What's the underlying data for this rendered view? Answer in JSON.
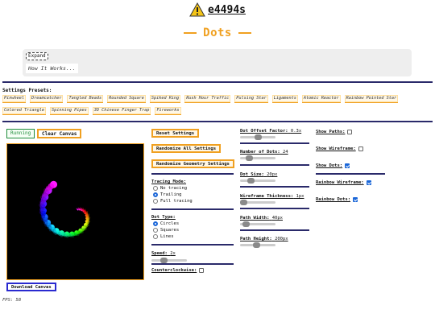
{
  "header": {
    "logo_text": "e4494s",
    "title": "Dots"
  },
  "expand": {
    "button_label": "Expand",
    "how_label": "How It Works..."
  },
  "presets": {
    "title": "Settings Presets:",
    "items": [
      "Pinwheel",
      "Dreamcatcher",
      "Tangled Beads",
      "Rounded Square",
      "Spiked Ring",
      "Rush Hour Traffic",
      "Pulsing Star",
      "Ligaments",
      "Atomic Reactor",
      "Rainbow Pointed Star",
      "Colored Triangle",
      "Spinning Pipes",
      "3D Chinese Finger Trap",
      "Fireworks"
    ]
  },
  "controls": {
    "running_label": "Running",
    "clear_label": "Clear Canvas",
    "download_label": "Download Canvas",
    "fps_label": "FPS: 58",
    "reset_label": "Reset Settings",
    "randomize_all_label": "Randomize All Settings",
    "randomize_geometry_label": "Randomize Geometry Settings"
  },
  "tracing": {
    "label": "Tracing Mode:",
    "options": [
      "No tracing",
      "Trailing",
      "Full tracing"
    ],
    "selected": "Trailing"
  },
  "dot_type": {
    "label": "Dot Type:",
    "options": [
      "Circles",
      "Squares",
      "Lines"
    ],
    "selected": "Circles"
  },
  "speed": {
    "label": "Speed:",
    "value": "2x",
    "level": 0.35
  },
  "counterclockwise": {
    "label": "Counterclockwise:",
    "checked": false
  },
  "dot_offset": {
    "label": "Dot Offset Factor:",
    "value": "0.3x",
    "level": 0.5
  },
  "num_dots": {
    "label": "Number of Dots:",
    "value": "24",
    "level": 0.25
  },
  "dot_size": {
    "label": "Dot Size:",
    "value": "20px",
    "level": 0.3
  },
  "wireframe_thickness": {
    "label": "Wireframe Thickness:",
    "value": "1px",
    "level": 0.05
  },
  "path_width": {
    "label": "Path Width:",
    "value": "40px",
    "level": 0.15
  },
  "path_height": {
    "label": "Path Height:",
    "value": "200px",
    "level": 0.45
  },
  "toggles": {
    "show_paths": {
      "label": "Show Paths:",
      "checked": false
    },
    "show_wireframe": {
      "label": "Show Wireframe:",
      "checked": false
    },
    "show_dots": {
      "label": "Show Dots:",
      "checked": true
    },
    "rainbow_wireframe": {
      "label": "Rainbow Wireframe:",
      "checked": true
    },
    "rainbow_dots": {
      "label": "Rainbow Dots:",
      "checked": true
    }
  },
  "colors": {
    "accent": "#f0a020",
    "rule": "#2a2a6a",
    "running": "#1e8c3a",
    "download": "#2a2ad0"
  },
  "icons": {
    "warning": "warning-icon"
  }
}
